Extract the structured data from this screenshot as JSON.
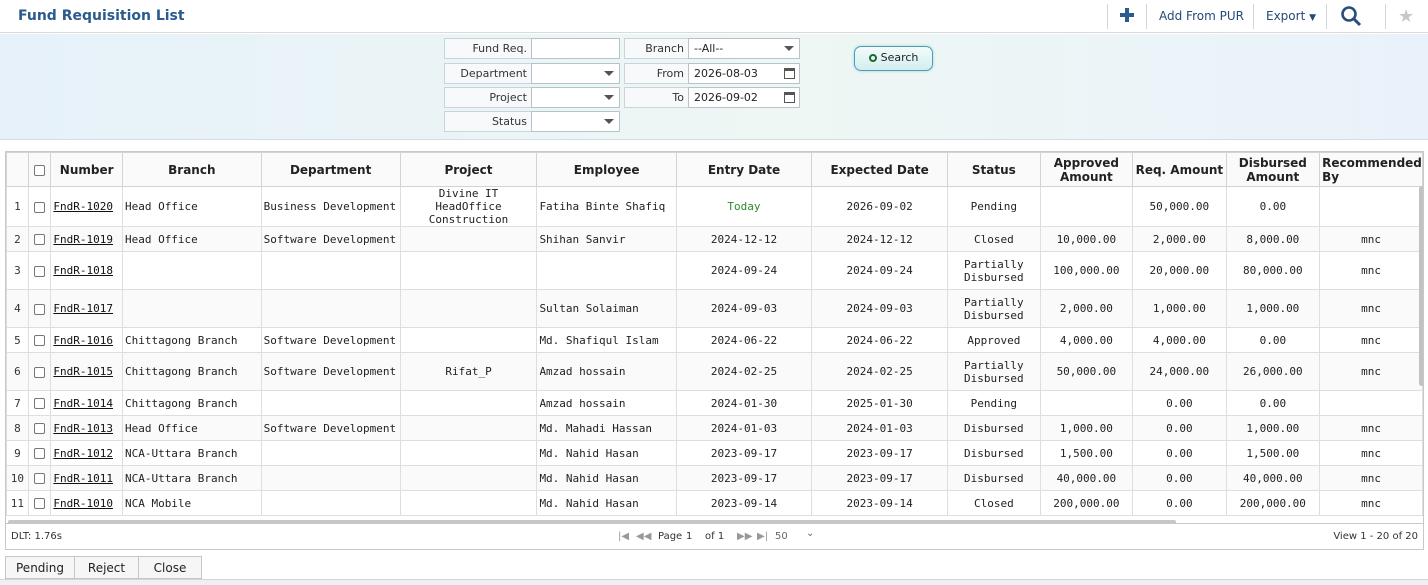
{
  "header": {
    "title": "Fund Requisition List",
    "add_from_pur": "Add From PUR",
    "export": "Export"
  },
  "filters": {
    "fund_req_label": "Fund Req.",
    "fund_req_value": "",
    "department_label": "Department",
    "project_label": "Project",
    "status_label": "Status",
    "branch_label": "Branch",
    "branch_value": "--All--",
    "from_label": "From",
    "from_value": "2026-08-03",
    "to_label": "To",
    "to_value": "2026-09-02",
    "search_label": "Search"
  },
  "grid": {
    "columns": [
      "Number",
      "Branch",
      "Department",
      "Project",
      "Employee",
      "Entry Date",
      "Expected Date",
      "Status",
      "Approved Amount",
      "Req. Amount",
      "Disbursed Amount",
      "Recommended By"
    ],
    "rows": [
      {
        "n": "1",
        "number": "FndR-1020",
        "branch": "Head Office",
        "department": "Business Development",
        "project": "Divine IT HeadOffice Construction",
        "employee": "Fatiha Binte Shafiq",
        "entry": "Today",
        "expected": "2026-09-02",
        "status": "Pending",
        "approved": "",
        "req": "50,000.00",
        "disbursed": "0.00",
        "rec": ""
      },
      {
        "n": "2",
        "number": "FndR-1019",
        "branch": "Head Office",
        "department": "Software Development",
        "project": "",
        "employee": "Shihan Sanvir",
        "entry": "2024-12-12",
        "expected": "2024-12-12",
        "status": "Closed",
        "approved": "10,000.00",
        "req": "2,000.00",
        "disbursed": "8,000.00",
        "rec": "mnc"
      },
      {
        "n": "3",
        "number": "FndR-1018",
        "branch": "",
        "department": "",
        "project": "",
        "employee": "",
        "entry": "2024-09-24",
        "expected": "2024-09-24",
        "status": "Partially Disbursed",
        "approved": "100,000.00",
        "req": "20,000.00",
        "disbursed": "80,000.00",
        "rec": "mnc"
      },
      {
        "n": "4",
        "number": "FndR-1017",
        "branch": "",
        "department": "",
        "project": "",
        "employee": "Sultan Solaiman",
        "entry": "2024-09-03",
        "expected": "2024-09-03",
        "status": "Partially Disbursed",
        "approved": "2,000.00",
        "req": "1,000.00",
        "disbursed": "1,000.00",
        "rec": "mnc"
      },
      {
        "n": "5",
        "number": "FndR-1016",
        "branch": "Chittagong Branch",
        "department": "Software Development",
        "project": "",
        "employee": "Md. Shafiqul Islam",
        "entry": "2024-06-22",
        "expected": "2024-06-22",
        "status": "Approved",
        "approved": "4,000.00",
        "req": "4,000.00",
        "disbursed": "0.00",
        "rec": "mnc"
      },
      {
        "n": "6",
        "number": "FndR-1015",
        "branch": "Chittagong Branch",
        "department": "Software Development",
        "project": "Rifat_P",
        "employee": "Amzad hossain",
        "entry": "2024-02-25",
        "expected": "2024-02-25",
        "status": "Partially Disbursed",
        "approved": "50,000.00",
        "req": "24,000.00",
        "disbursed": "26,000.00",
        "rec": "mnc"
      },
      {
        "n": "7",
        "number": "FndR-1014",
        "branch": "Chittagong Branch",
        "department": "",
        "project": "",
        "employee": "Amzad hossain",
        "entry": "2024-01-30",
        "expected": "2025-01-30",
        "status": "Pending",
        "approved": "",
        "req": "0.00",
        "disbursed": "0.00",
        "rec": ""
      },
      {
        "n": "8",
        "number": "FndR-1013",
        "branch": "Head Office",
        "department": "Software Development",
        "project": "",
        "employee": "Md. Mahadi Hassan",
        "entry": "2024-01-03",
        "expected": "2024-01-03",
        "status": "Disbursed",
        "approved": "1,000.00",
        "req": "0.00",
        "disbursed": "1,000.00",
        "rec": "mnc"
      },
      {
        "n": "9",
        "number": "FndR-1012",
        "branch": "NCA-Uttara Branch",
        "department": "",
        "project": "",
        "employee": "Md. Nahid Hasan",
        "entry": "2023-09-17",
        "expected": "2023-09-17",
        "status": "Disbursed",
        "approved": "1,500.00",
        "req": "0.00",
        "disbursed": "1,500.00",
        "rec": "mnc"
      },
      {
        "n": "10",
        "number": "FndR-1011",
        "branch": "NCA-Uttara Branch",
        "department": "",
        "project": "",
        "employee": "Md. Nahid Hasan",
        "entry": "2023-09-17",
        "expected": "2023-09-17",
        "status": "Disbursed",
        "approved": "40,000.00",
        "req": "0.00",
        "disbursed": "40,000.00",
        "rec": "mnc"
      },
      {
        "n": "11",
        "number": "FndR-1010",
        "branch": "NCA Mobile",
        "department": "",
        "project": "",
        "employee": "Md. Nahid Hasan",
        "entry": "2023-09-14",
        "expected": "2023-09-14",
        "status": "Closed",
        "approved": "200,000.00",
        "req": "0.00",
        "disbursed": "200,000.00",
        "rec": "mnc"
      }
    ]
  },
  "pager": {
    "dlt": "DLT: 1.76s",
    "page_label": "Page",
    "page_value": "1",
    "of_label": "of 1",
    "page_size": "50",
    "view_text": "View 1 - 20 of 20"
  },
  "footer": {
    "pending": "Pending",
    "reject": "Reject",
    "close": "Close"
  }
}
